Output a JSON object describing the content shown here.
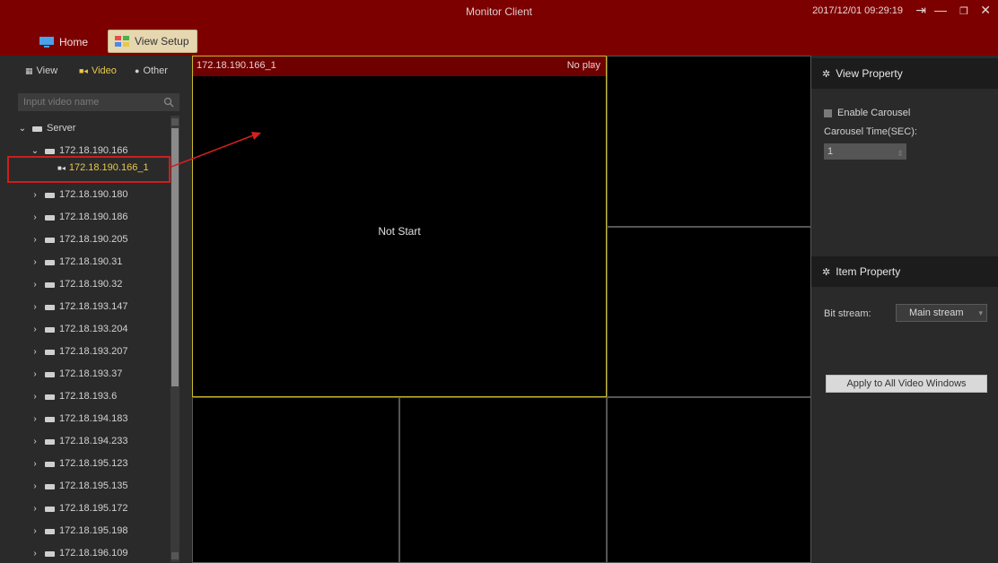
{
  "titlebar": {
    "app_title": "Monitor Client",
    "clock": "2017/12/01 09:29:19",
    "tabs": [
      {
        "label": "Home"
      },
      {
        "label": "View Setup"
      }
    ]
  },
  "left": {
    "subtabs": [
      {
        "label": "View"
      },
      {
        "label": "Video"
      },
      {
        "label": "Other"
      }
    ],
    "search_placeholder": "Input video name",
    "tree": {
      "root": "Server",
      "expanded_device": "172.18.190.166",
      "selected_camera": "172.18.190.166_1",
      "devices": [
        "172.18.190.180",
        "172.18.190.186",
        "172.18.190.205",
        "172.18.190.31",
        "172.18.190.32",
        "172.18.193.147",
        "172.18.193.204",
        "172.18.193.207",
        "172.18.193.37",
        "172.18.193.6",
        "172.18.194.183",
        "172.18.194.233",
        "172.18.195.123",
        "172.18.195.135",
        "172.18.195.172",
        "172.18.195.198",
        "172.18.196.109"
      ]
    }
  },
  "video": {
    "window_name": "172.18.190.166_1",
    "status": "No play",
    "center_text": "Not Start"
  },
  "right": {
    "view_property": {
      "title": "View Property",
      "enable_carousel": "Enable Carousel",
      "carousel_label": "Carousel Time(SEC):",
      "carousel_value": "1"
    },
    "item_property": {
      "title": "Item Property",
      "bitstream_label": "Bit stream:",
      "bitstream_value": "Main stream",
      "apply_label": "Apply to All Video Windows"
    }
  },
  "colors": {
    "accent": "#7c0000",
    "highlight": "#e8c84a",
    "annotation": "#cc1f1f"
  }
}
